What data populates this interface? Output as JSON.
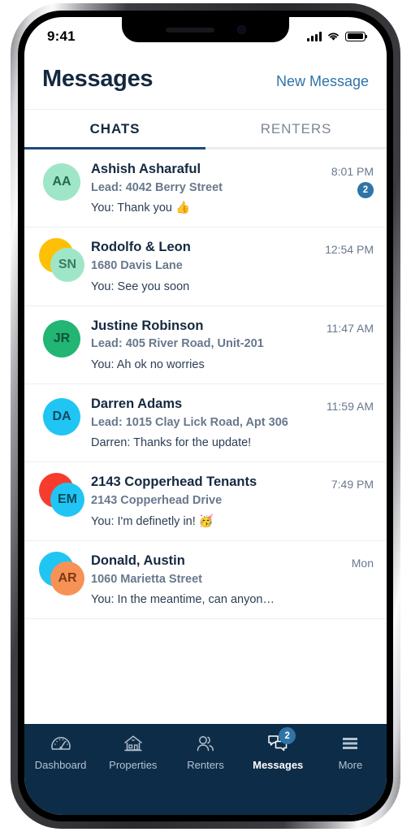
{
  "status_bar": {
    "time": "9:41",
    "signal_icon": "cellular-bars-icon",
    "wifi_icon": "wifi-icon",
    "battery_icon": "battery-icon"
  },
  "header": {
    "title": "Messages",
    "action_label": "New Message",
    "action_color": "#2f74a8"
  },
  "tabs": [
    {
      "label": "CHATS",
      "active": true
    },
    {
      "label": "RENTERS",
      "active": false
    }
  ],
  "colors": {
    "navy": "#0d2c47",
    "title_navy": "#14293f",
    "accent_blue": "#2f74a8",
    "tab_underline": "#1c4a7a",
    "muted_text": "#68788c"
  },
  "chats": [
    {
      "name": "Ashish Asharaful",
      "subtitle": "Lead: 4042 Berry Street",
      "preview": "You: Thank you ",
      "preview_emoji": "👍",
      "time": "8:01 PM",
      "unread": "2",
      "avatar_type": "single",
      "avatars": [
        {
          "initials": "AA",
          "bg": "#9fe6c8",
          "fg": "#1f6b4a"
        }
      ]
    },
    {
      "name": "Rodolfo & Leon",
      "subtitle": "1680 Davis Lane",
      "preview": "You: See you soon",
      "preview_emoji": "",
      "time": "12:54 PM",
      "unread": "",
      "avatar_type": "stacked",
      "avatars": [
        {
          "initials": "",
          "bg": "#fec006",
          "fg": "#ffffff"
        },
        {
          "initials": "SN",
          "bg": "#9fe6c8",
          "fg": "#3b7a62"
        }
      ]
    },
    {
      "name": "Justine Robinson",
      "subtitle": "Lead: 405 River Road, Unit-201",
      "preview": "You: Ah ok no worries",
      "preview_emoji": "",
      "time": "11:47 AM",
      "unread": "",
      "avatar_type": "single",
      "avatars": [
        {
          "initials": "JR",
          "bg": "#22b573",
          "fg": "#0f5338"
        }
      ]
    },
    {
      "name": "Darren Adams",
      "subtitle": "Lead: 1015 Clay Lick Road, Apt 306",
      "preview": "Darren: Thanks for the update!",
      "preview_emoji": "",
      "time": "11:59 AM",
      "unread": "",
      "avatar_type": "single",
      "avatars": [
        {
          "initials": "DA",
          "bg": "#21c5f3",
          "fg": "#0d4a60"
        }
      ]
    },
    {
      "name": "2143 Copperhead Tenants",
      "subtitle": "2143 Copperhead Drive",
      "preview": "You: I'm definetly in! ",
      "preview_emoji": "🥳",
      "time": "7:49 PM",
      "unread": "",
      "avatar_type": "stacked",
      "avatars": [
        {
          "initials": "",
          "bg": "#f73c2e",
          "fg": "#ffffff"
        },
        {
          "initials": "EM",
          "bg": "#21c5f3",
          "fg": "#0d4a60"
        }
      ]
    },
    {
      "name": "Donald, Austin",
      "subtitle": "1060 Marietta Street",
      "preview": "You: In the meantime, can anyon…",
      "preview_emoji": "",
      "time": "Mon",
      "unread": "",
      "avatar_type": "stacked",
      "avatars": [
        {
          "initials": "",
          "bg": "#21c5f3",
          "fg": "#ffffff"
        },
        {
          "initials": "AR",
          "bg": "#f79256",
          "fg": "#7a3a12"
        }
      ]
    }
  ],
  "bottom_nav": [
    {
      "label": "Dashboard",
      "icon": "speedometer-icon",
      "active": false,
      "badge": ""
    },
    {
      "label": "Properties",
      "icon": "house-icon",
      "active": false,
      "badge": ""
    },
    {
      "label": "Renters",
      "icon": "people-icon",
      "active": false,
      "badge": ""
    },
    {
      "label": "Messages",
      "icon": "chat-bubbles-icon",
      "active": true,
      "badge": "2"
    },
    {
      "label": "More",
      "icon": "hamburger-list-icon",
      "active": false,
      "badge": ""
    }
  ]
}
